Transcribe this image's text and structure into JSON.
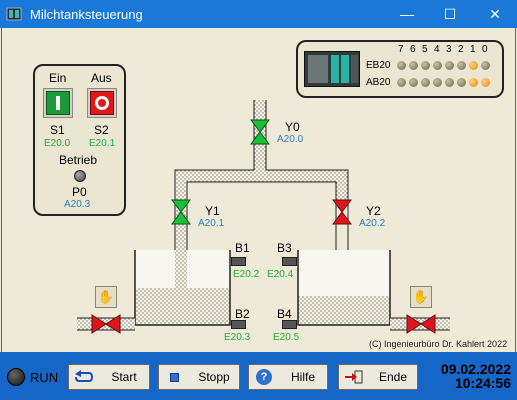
{
  "window": {
    "title": "Milchtanksteuerung",
    "minimize": "—",
    "maximize": "☐",
    "close": "✕"
  },
  "control_panel": {
    "on_label": "Ein",
    "off_label": "Aus",
    "s1_name": "S1",
    "s1_addr": "E20.0",
    "s2_name": "S2",
    "s2_addr": "E20.1",
    "betrieb_label": "Betrieb",
    "p0_name": "P0",
    "p0_addr": "A20.3"
  },
  "io_panel": {
    "bit_labels": [
      "7",
      "6",
      "5",
      "4",
      "3",
      "2",
      "1",
      "0"
    ],
    "eb_label": "EB20",
    "ab_label": "AB20",
    "eb_bits": [
      0,
      0,
      0,
      0,
      0,
      0,
      1,
      0
    ],
    "ab_bits": [
      0,
      0,
      0,
      0,
      0,
      0,
      1,
      1
    ]
  },
  "valves": {
    "y0_name": "Y0",
    "y0_addr": "A20.0",
    "y1_name": "Y1",
    "y1_addr": "A20.1",
    "y2_name": "Y2",
    "y2_addr": "A20.2"
  },
  "sensors": {
    "b1_name": "B1",
    "b1_addr": "E20.2",
    "b2_name": "B2",
    "b2_addr": "E20.3",
    "b3_name": "B3",
    "b3_addr": "E20.4",
    "b4_name": "B4",
    "b4_addr": "E20.5"
  },
  "copyright": "(C) Ingenieurbüro Dr. Kahlert 2022",
  "status": {
    "run_label": "RUN"
  },
  "buttons": {
    "start": "Start",
    "stopp": "Stopp",
    "hilfe": "Hilfe",
    "ende": "Ende"
  },
  "datetime": {
    "date": "09.02.2022",
    "time": "10:24:56"
  },
  "colors": {
    "titlebar": "#1a78d8",
    "bottombar": "#1566c6",
    "valve_open": "#19c23a",
    "valve_closed": "#e0141e",
    "address_green": "#1fae3a",
    "address_blue": "#2a7fbf"
  }
}
